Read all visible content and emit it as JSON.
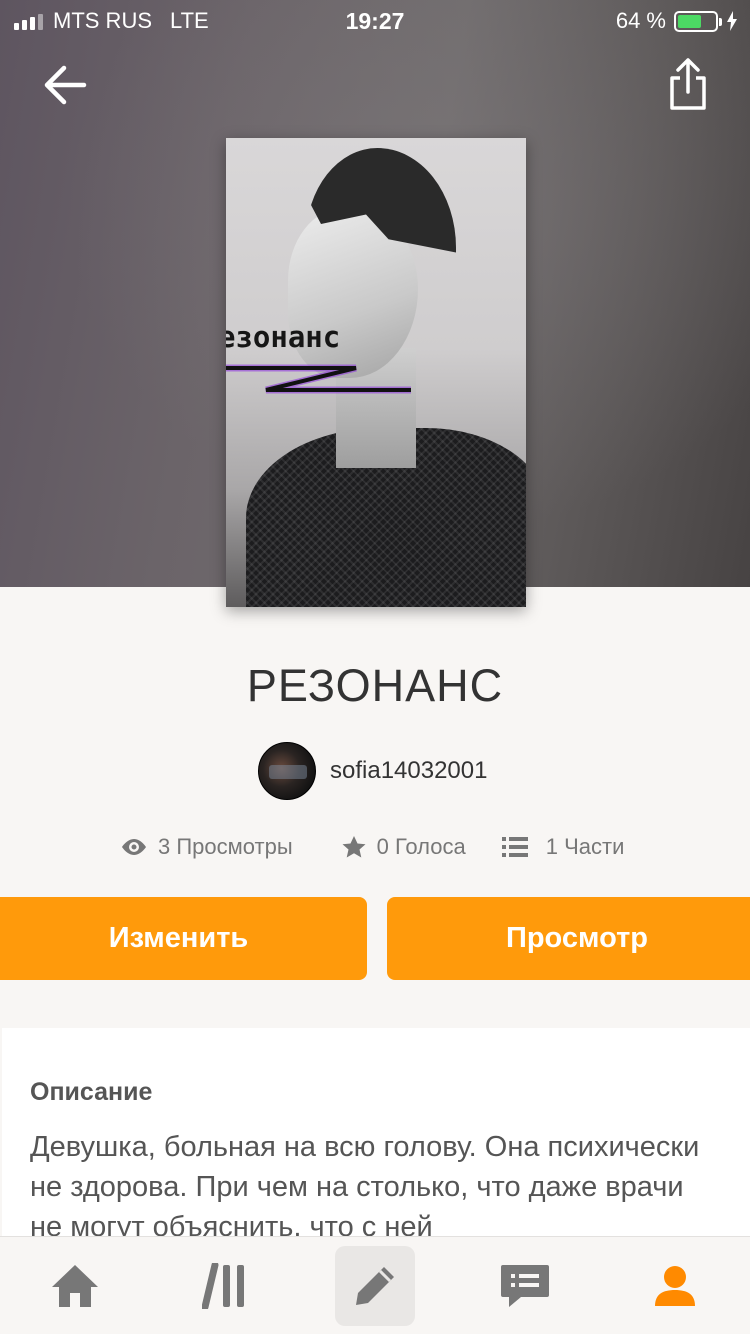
{
  "status_bar": {
    "carrier": "MTS RUS",
    "network": "LTE",
    "time": "19:27",
    "battery": "64 %",
    "battery_level": 0.64
  },
  "header": {
    "back_icon": "arrow-left-icon",
    "share_icon": "share-icon"
  },
  "cover": {
    "title_text": "езонанс"
  },
  "book": {
    "title": "РЕЗОНАНС",
    "author": "sofia14032001"
  },
  "stats": {
    "views": "3 Просмотры",
    "votes": "0 Голоса",
    "parts": "1 Части"
  },
  "actions": {
    "edit_label": "Изменить",
    "view_label": "Просмотр"
  },
  "description": {
    "heading": "Описание",
    "text": "Девушка, больная на всю голову. Она психически не здорова. При чем на столько, что даже врачи не могут объяснить, что с ней"
  },
  "tabbar": {
    "items": [
      "home-icon",
      "library-icon",
      "write-icon",
      "messages-icon",
      "profile-icon"
    ],
    "active": "write-icon",
    "accent": "#ff9a0b"
  }
}
